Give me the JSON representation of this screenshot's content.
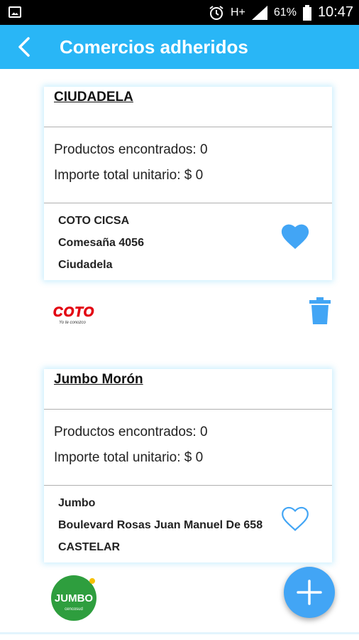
{
  "status_bar": {
    "network_type": "H+",
    "battery_percent": "61%",
    "time": "10:47",
    "icons": [
      "image-icon",
      "alarm-icon",
      "signal-icon",
      "battery-icon"
    ]
  },
  "app_bar": {
    "title": "Comercios adheridos",
    "back_icon": "back-arrow-icon",
    "color": "#29b6f6"
  },
  "stores": [
    {
      "name": "CIUDADELA",
      "products_line": "Productos encontrados: 0",
      "total_line": "Importe total unitario: $ 0",
      "company": "COTO CICSA",
      "address": "Comesaña 4056",
      "city": "Ciudadela",
      "favorite": true,
      "logo": {
        "text": "COTO",
        "tagline": "Yo te conozco",
        "color": "#e30613"
      }
    },
    {
      "name": "Jumbo Morón",
      "products_line": "Productos encontrados: 0",
      "total_line": "Importe total unitario: $ 0",
      "company": "Jumbo",
      "address": "Boulevard Rosas Juan Manuel De 658",
      "city": "CASTELAR",
      "favorite": false,
      "logo": {
        "text": "JUMBO",
        "tagline": "cencosud",
        "color": "#2e9e3e"
      }
    }
  ],
  "fab_icon": "plus-icon",
  "accent_color": "#42a5f5"
}
